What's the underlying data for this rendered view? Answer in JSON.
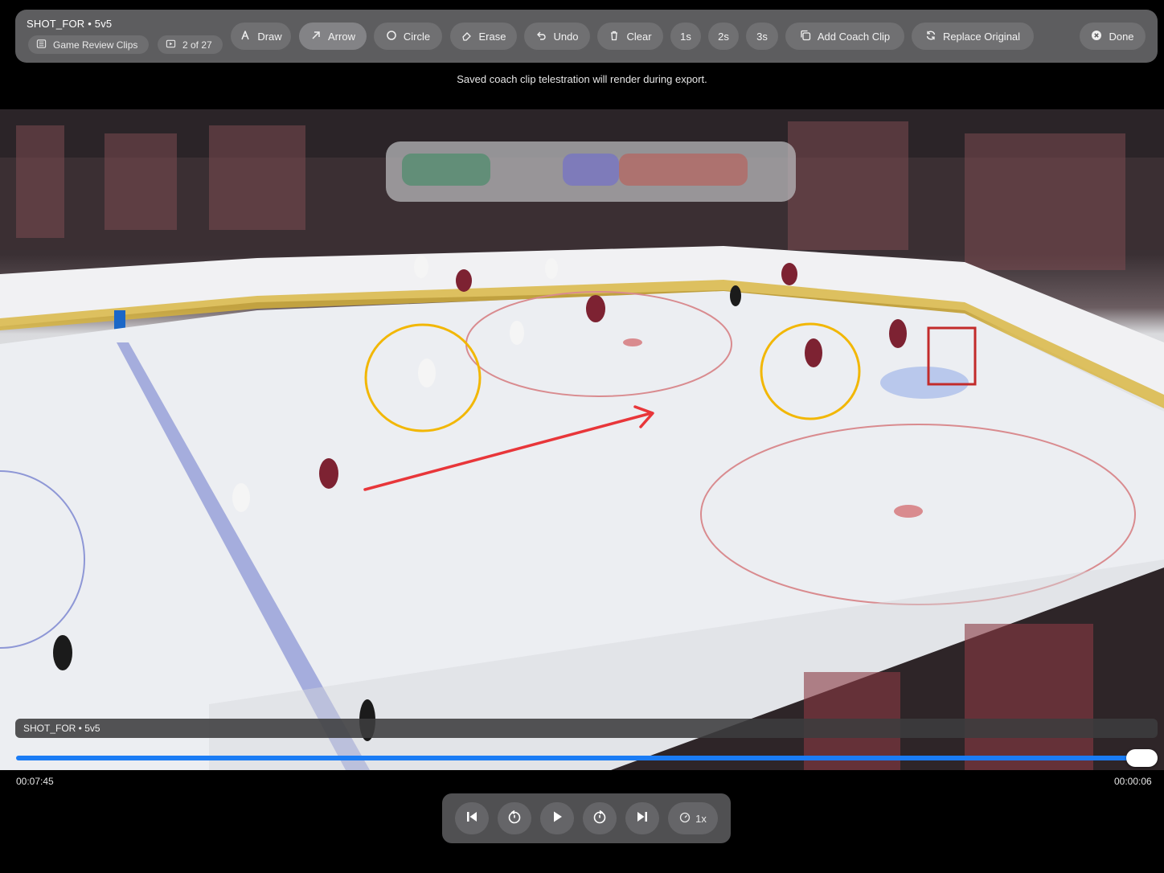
{
  "toolbar": {
    "title": "SHOT_FOR • 5v5",
    "collection_chip": "Game Review Clips",
    "position_chip": "2 of 27",
    "tools": {
      "draw": "Draw",
      "arrow": "Arrow",
      "circle": "Circle",
      "erase": "Erase",
      "undo": "Undo",
      "clear": "Clear"
    },
    "durations": [
      "1s",
      "2s",
      "3s"
    ],
    "add_coach_clip": "Add Coach Clip",
    "replace_original": "Replace Original",
    "done": "Done",
    "active_tool": "arrow"
  },
  "notice": "Saved coach clip telestration will render during export.",
  "player": {
    "clip_label": "SHOT_FOR • 5v5",
    "current_time": "00:07:45",
    "remaining_time": "00:00:06",
    "progress": 1.0,
    "speed": "1x"
  },
  "telestration": {
    "circle_color": "#f2b705",
    "arrow_color": "#e8363a"
  },
  "colors": {
    "accent": "#1a7cf5",
    "toolbar_bg": "#5d5d5f"
  }
}
